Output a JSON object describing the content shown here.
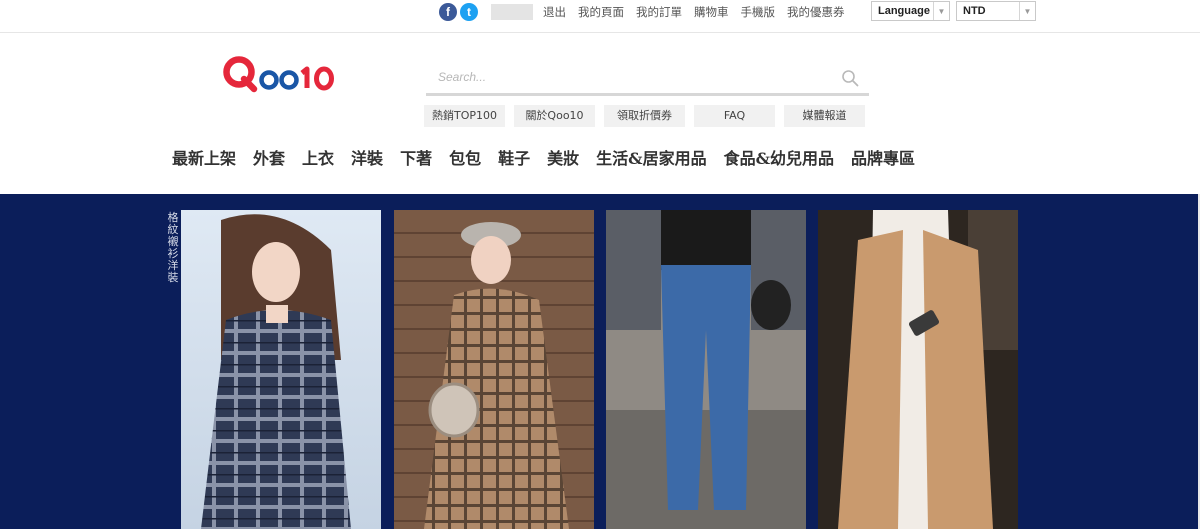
{
  "topbar": {
    "social": [
      {
        "icon": "facebook-icon",
        "glyph": "f"
      },
      {
        "icon": "twitter-icon",
        "glyph": "t"
      }
    ],
    "links": [
      "退出",
      "我的頁面",
      "我的訂單",
      "購物車",
      "手機版",
      "我的優惠券"
    ],
    "language_select": "Language",
    "currency_select": "NTD"
  },
  "header": {
    "logo_text": "Qoo10",
    "search_placeholder": "Search...",
    "quick_links": [
      "熱銷TOP100",
      "關於Qoo10",
      "領取折價券",
      "FAQ",
      "媒體報道"
    ],
    "categories": [
      "最新上架",
      "外套",
      "上衣",
      "洋裝",
      "下著",
      "包包",
      "鞋子",
      "美妝",
      "生活&居家用品",
      "食品&幼兒用品",
      "品牌專區"
    ]
  },
  "banner": {
    "vertical_text": "格紋襯衫洋裝",
    "photos": [
      {
        "name": "plaid-shirt-dress-photo"
      },
      {
        "name": "beret-plaid-dress-photo"
      },
      {
        "name": "blue-jeans-photo"
      },
      {
        "name": "camel-vest-photo"
      }
    ]
  },
  "colors": {
    "brand_red": "#e5273b",
    "brand_blue": "#1a56a6",
    "banner_navy": "#0b1e5a"
  }
}
